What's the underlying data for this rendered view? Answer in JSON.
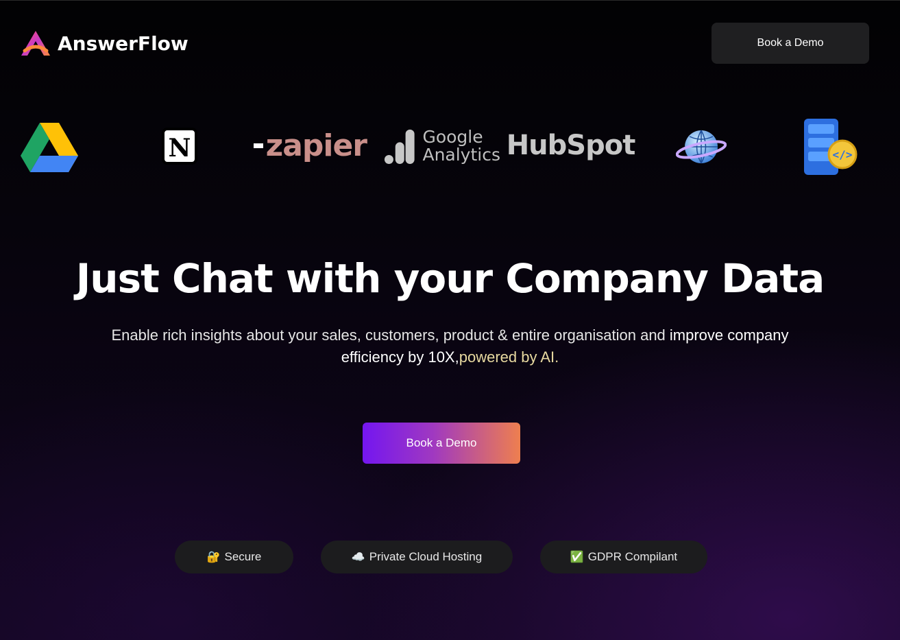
{
  "brand": {
    "name": "AnswerFlow"
  },
  "header": {
    "cta_label": "Book a Demo"
  },
  "integrations": {
    "zapier": "zapier",
    "google_analytics_line1": "Google",
    "google_analytics_line2": "Analytics",
    "hubspot": "HubSpot"
  },
  "hero": {
    "title": "Just Chat with your Company Data",
    "subtitle_part1": "Enable rich insights about your sales, customers, product & entire organisation and ",
    "subtitle_strong": "improve company efficiency by 10X",
    "subtitle_comma": ",",
    "subtitle_accent": "powered by AI",
    "subtitle_end": ".",
    "cta_label": "Book a Demo"
  },
  "badges": [
    {
      "icon": "lock-key-icon",
      "glyph": "🔐",
      "label": "Secure"
    },
    {
      "icon": "cloud-icon",
      "glyph": "☁️",
      "label": "Private Cloud Hosting"
    },
    {
      "icon": "check-icon",
      "glyph": "✅",
      "label": "GDPR Compilant"
    }
  ],
  "colors": {
    "accent_purple": "#7416f0",
    "accent_orange": "#ee7f4f",
    "button_dark": "#1f1f21",
    "highlight_text": "#e8d9a0"
  }
}
